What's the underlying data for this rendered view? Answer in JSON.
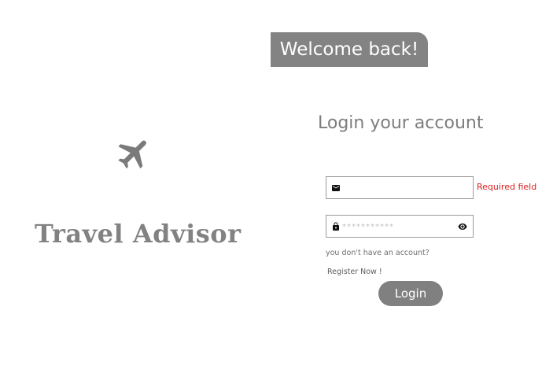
{
  "brand": {
    "title": "Travel Advisor",
    "icon": "airplane-icon"
  },
  "welcome": {
    "text": "Welcome back!"
  },
  "login": {
    "heading": "Login your account",
    "email": {
      "icon": "envelope-icon",
      "value": "",
      "placeholder": "",
      "error": "Required field"
    },
    "password": {
      "icon": "lock-icon",
      "value": "",
      "placeholder": "***********",
      "toggle_icon": "eye-icon"
    },
    "no_account_text": "you don't have an account?",
    "register_label": "Register Now !",
    "button_label": "Login"
  },
  "colors": {
    "primary_gray": "#838383",
    "error_red": "#e01b1b",
    "text_gray": "#7b7b7b"
  }
}
